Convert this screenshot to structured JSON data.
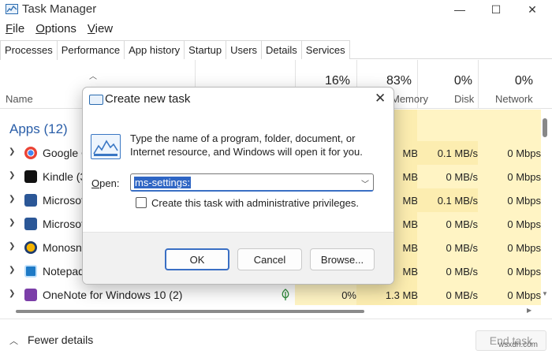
{
  "window": {
    "title": "Task Manager",
    "minimize": "—",
    "maximize": "☐",
    "close": "✕"
  },
  "menu": [
    {
      "label": "File",
      "accel": "F",
      "rest": "ile"
    },
    {
      "label": "Options",
      "accel": "O",
      "rest": "ptions"
    },
    {
      "label": "View",
      "accel": "V",
      "rest": "iew"
    }
  ],
  "tabs": [
    "Processes",
    "Performance",
    "App history",
    "Startup",
    "Users",
    "Details",
    "Services"
  ],
  "header": {
    "name": "Name",
    "cpu_pct": "16%",
    "mem_pct": "83%",
    "disk_pct": "0%",
    "net_pct": "0%",
    "mem_label": "Memory",
    "disk_label": "Disk",
    "net_label": "Network"
  },
  "group": {
    "title": "Apps (12)"
  },
  "rows": [
    {
      "name": "Google C",
      "icon": "chrome-icon",
      "mem": "MB",
      "disk": "0.1 MB/s",
      "net": "0 Mbps"
    },
    {
      "name": "Kindle (3",
      "icon": "kindle-icon",
      "mem": "MB",
      "disk": "0 MB/s",
      "net": "0 Mbps"
    },
    {
      "name": "Microsof",
      "icon": "word-icon",
      "mem": "MB",
      "disk": "0.1 MB/s",
      "net": "0 Mbps"
    },
    {
      "name": "Microsof",
      "icon": "word-icon",
      "mem": "MB",
      "disk": "0 MB/s",
      "net": "0 Mbps"
    },
    {
      "name": "Monosna",
      "icon": "monosnap-icon",
      "mem": "MB",
      "disk": "0 MB/s",
      "net": "0 Mbps"
    },
    {
      "name": "Notepad",
      "icon": "notepad-icon",
      "mem": "MB",
      "disk": "0 MB/s",
      "net": "0 Mbps"
    },
    {
      "name": "OneNote for Windows 10 (2)",
      "icon": "onenote-icon",
      "cpu": "0%",
      "mem": "1.3 MB",
      "disk": "0 MB/s",
      "net": "0 Mbps"
    }
  ],
  "footer": {
    "fewer_details": "Fewer details",
    "end_task": "End task"
  },
  "dialog": {
    "title": "Create new task",
    "close": "✕",
    "message": "Type the name of a program, folder, document, or Internet resource, and Windows will open it for you.",
    "open_label": "Open:",
    "open_value": "ms-settings:",
    "admin_label": "Create this task with administrative privileges.",
    "admin_checked": false,
    "ok": "OK",
    "cancel": "Cancel",
    "browse": "Browse..."
  },
  "watermark": "wsxdn.com",
  "colors": {
    "accent": "#2f66c4",
    "group_title": "#2a5ea8",
    "heat_light": "#fff4c4",
    "heat_mid": "#fcedb0"
  }
}
